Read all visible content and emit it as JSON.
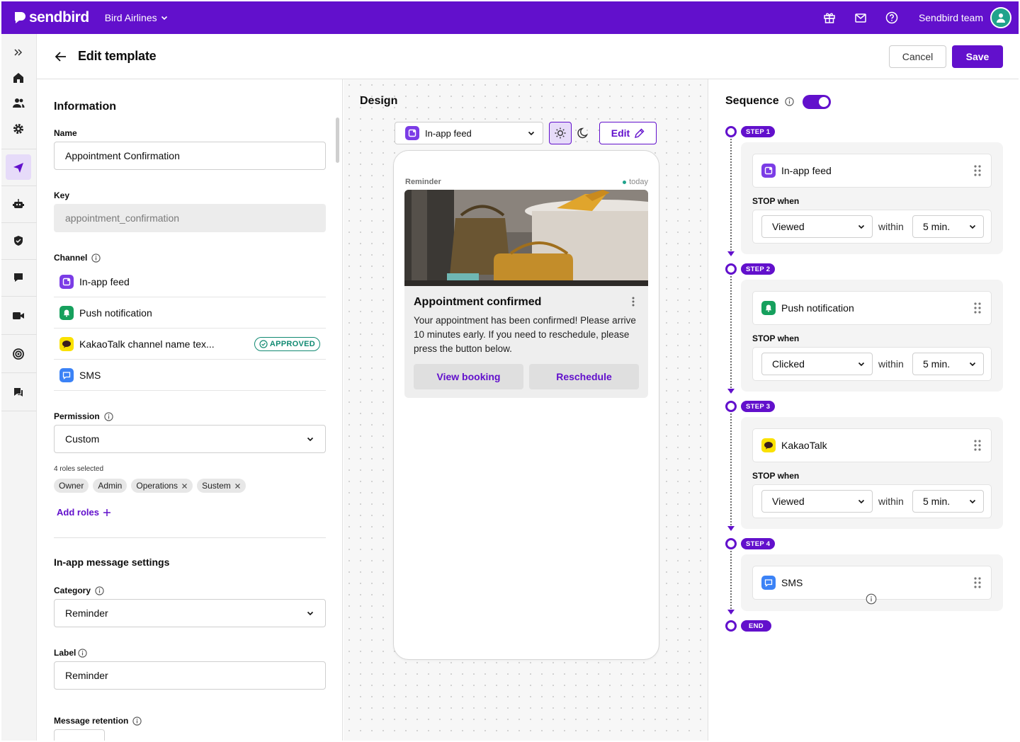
{
  "topbar": {
    "brand": "sendbird",
    "org": "Bird Airlines",
    "team": "Sendbird team"
  },
  "header": {
    "title": "Edit template",
    "cancel": "Cancel",
    "save": "Save"
  },
  "info": {
    "section_title": "Information",
    "name_label": "Name",
    "name_value": "Appointment Confirmation",
    "key_label": "Key",
    "key_value": "appointment_confirmation",
    "channel_label": "Channel",
    "channels": [
      {
        "label": "In-app feed",
        "icon": "in-app-feed-icon",
        "color": "#7b3ce6"
      },
      {
        "label": "Push notification",
        "icon": "bell-icon",
        "color": "#16a05d"
      },
      {
        "label": "KakaoTalk channel name tex...",
        "icon": "kakaotalk-icon",
        "color": "#fae100",
        "badge": "APPROVED"
      },
      {
        "label": "SMS",
        "icon": "sms-icon",
        "color": "#3b82f6"
      }
    ],
    "permission_label": "Permission",
    "permission_value": "Custom",
    "roles_count": "4 roles selected",
    "roles": [
      "Owner",
      "Admin",
      "Operations",
      "Sustem"
    ],
    "add_roles": "Add roles",
    "inapp_title": "In-app message settings",
    "category_label": "Category",
    "category_value": "Reminder",
    "label_label": "Label",
    "label_value": "Reminder",
    "retention_label": "Message retention"
  },
  "design": {
    "title": "Design",
    "channel_select": "In-app feed",
    "edit": "Edit",
    "card": {
      "category": "Reminder",
      "time": "today",
      "title": "Appointment confirmed",
      "body": "Your appointment has been confirmed! Please arrive 10 minutes early. If you need to reschedule, please press the button below.",
      "buttons": [
        "View booking",
        "Reschedule"
      ]
    }
  },
  "sequence": {
    "title": "Sequence",
    "enabled": true,
    "stop_label": "STOP when",
    "within_label": "within",
    "end_label": "END",
    "steps": [
      {
        "pill": "STEP 1",
        "channel": "In-app feed",
        "condition": "Viewed",
        "within": "5 min."
      },
      {
        "pill": "STEP 2",
        "channel": "Push notification",
        "condition": "Clicked",
        "within": "5 min."
      },
      {
        "pill": "STEP 3",
        "channel": "KakaoTalk",
        "condition": "Viewed",
        "within": "5 min."
      },
      {
        "pill": "STEP 4",
        "channel": "SMS"
      }
    ]
  },
  "colors": {
    "brand": "#6210cc",
    "approved": "#118a72"
  }
}
